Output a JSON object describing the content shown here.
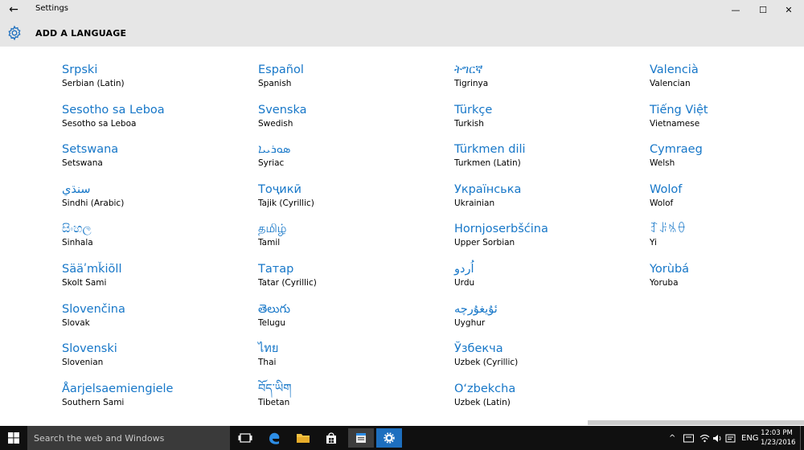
{
  "window": {
    "title": "Settings",
    "back_glyph": "←",
    "minimize_glyph": "—",
    "maximize_glyph": "☐",
    "close_glyph": "✕"
  },
  "header": {
    "icon": "gear-icon",
    "title": "ADD A LANGUAGE"
  },
  "columns": [
    [
      {
        "native": "Srpski",
        "english": "Serbian (Latin)"
      },
      {
        "native": "Sesotho sa Leboa",
        "english": "Sesotho sa Leboa"
      },
      {
        "native": "Setswana",
        "english": "Setswana"
      },
      {
        "native": "سنڌي",
        "english": "Sindhi (Arabic)"
      },
      {
        "native": "සිංහල",
        "english": "Sinhala"
      },
      {
        "native": "Sääʹmǩiõll",
        "english": "Skolt Sami"
      },
      {
        "native": "Slovenčina",
        "english": "Slovak"
      },
      {
        "native": "Slovenski",
        "english": "Slovenian"
      },
      {
        "native": "Åarjelsaemiengiele",
        "english": "Southern Sami"
      }
    ],
    [
      {
        "native": "Español",
        "english": "Spanish"
      },
      {
        "native": "Svenska",
        "english": "Swedish"
      },
      {
        "native": "ܣܘܪܝܝܐ",
        "english": "Syriac"
      },
      {
        "native": "Тоҷикӣ",
        "english": "Tajik (Cyrillic)"
      },
      {
        "native": "தமிழ்",
        "english": "Tamil"
      },
      {
        "native": "Татар",
        "english": "Tatar (Cyrillic)"
      },
      {
        "native": "తెలుగు",
        "english": "Telugu"
      },
      {
        "native": "ไทย",
        "english": "Thai"
      },
      {
        "native": "བོད་ཡིག",
        "english": "Tibetan"
      }
    ],
    [
      {
        "native": "ትግርኛ",
        "english": "Tigrinya"
      },
      {
        "native": "Türkçe",
        "english": "Turkish"
      },
      {
        "native": "Türkmen dili",
        "english": "Turkmen (Latin)"
      },
      {
        "native": "Українська",
        "english": "Ukrainian"
      },
      {
        "native": "Hornjoserbšćina",
        "english": "Upper Sorbian"
      },
      {
        "native": "اُردو",
        "english": "Urdu"
      },
      {
        "native": "ئۇيغۇرچە",
        "english": "Uyghur"
      },
      {
        "native": "Ўзбекча",
        "english": "Uzbek (Cyrillic)"
      },
      {
        "native": "O‘zbekcha",
        "english": "Uzbek (Latin)"
      }
    ],
    [
      {
        "native": "Valencià",
        "english": "Valencian"
      },
      {
        "native": "Tiếng Việt",
        "english": "Vietnamese"
      },
      {
        "native": "Cymraeg",
        "english": "Welsh"
      },
      {
        "native": "Wolof",
        "english": "Wolof"
      },
      {
        "native": "ꆈꌠꁱꂷ",
        "english": "Yi"
      },
      {
        "native": "Yorùbá",
        "english": "Yoruba"
      }
    ]
  ],
  "taskbar": {
    "search_placeholder": "Search the web and Windows",
    "input_indicator": "ENG",
    "time": "12:03 PM",
    "date": "1/23/2016"
  },
  "colors": {
    "link": "#1777c8",
    "accent": "#1d6fbf",
    "taskbar": "#101010"
  }
}
